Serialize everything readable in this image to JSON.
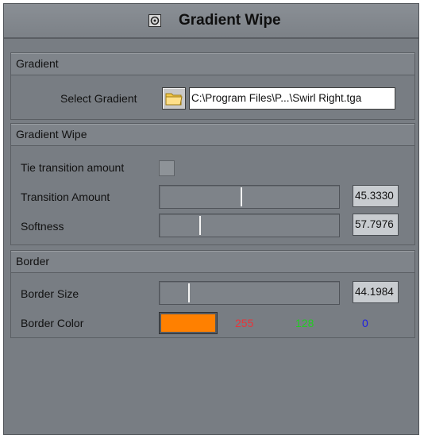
{
  "window": {
    "title": "Gradient Wipe",
    "title_icon": "swirl-icon"
  },
  "gradient": {
    "header": "Gradient",
    "select_label": "Select Gradient",
    "folder_icon": "folder-icon",
    "path": "C:\\Program Files\\P...\\Swirl Right.tga"
  },
  "gradient_wipe": {
    "header": "Gradient Wipe",
    "tie_label": "Tie transition amount",
    "transition_label": "Transition Amount",
    "transition_value": "45.3330",
    "transition_fraction": 0.45,
    "softness_label": "Softness",
    "softness_value": "57.7976",
    "softness_fraction": 0.22
  },
  "border": {
    "header": "Border",
    "size_label": "Border Size",
    "size_value": "44.1984",
    "size_fraction": 0.16,
    "color_label": "Border Color",
    "color_hex": "#ff8000",
    "r": "255",
    "g": "128",
    "b": "0",
    "r_color": "#e8343a",
    "g_color": "#22cc22",
    "b_color": "#2020e0"
  }
}
